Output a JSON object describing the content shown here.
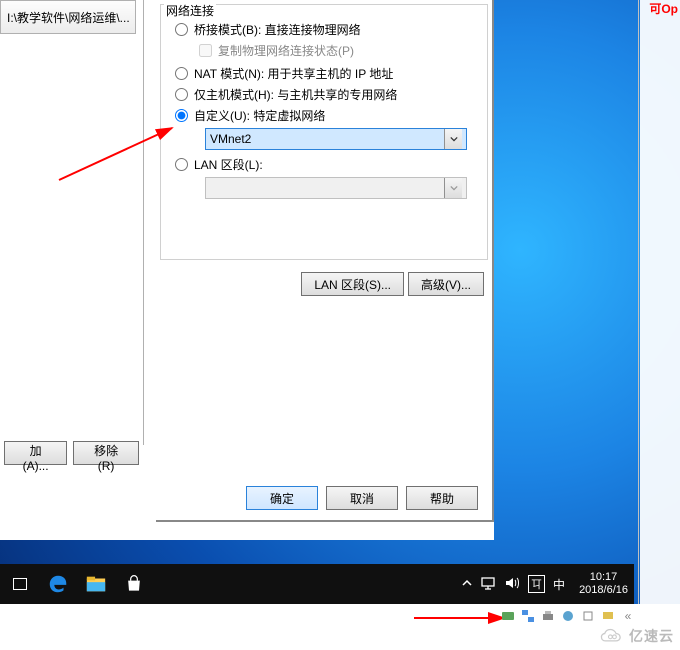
{
  "left_panel": {
    "folder_item": "I:\\教学软件\\网络运维\\...",
    "add_button_label": "加(A)...",
    "remove_button_label": "移除(R)"
  },
  "dialog": {
    "group_title": "网络连接",
    "radio_bridge": "桥接模式(B): 直接连接物理网络",
    "checkbox_replicate": "复制物理网络连接状态(P)",
    "radio_nat": "NAT 模式(N): 用于共享主机的 IP 地址",
    "radio_hostonly": "仅主机模式(H): 与主机共享的专用网络",
    "radio_custom": "自定义(U): 特定虚拟网络",
    "custom_dropdown_value": "VMnet2",
    "radio_lanseg": "LAN 区段(L):",
    "lanseg_dropdown_value": "",
    "btn_lanseg": "LAN 区段(S)...",
    "btn_advanced": "高级(V)...",
    "btn_ok": "确定",
    "btn_cancel": "取消",
    "btn_help": "帮助"
  },
  "taskbar": {
    "time": "10:17",
    "date": "2018/6/16",
    "ime": "中"
  },
  "top_right_text": "可Op",
  "watermark_text": "亿速云"
}
